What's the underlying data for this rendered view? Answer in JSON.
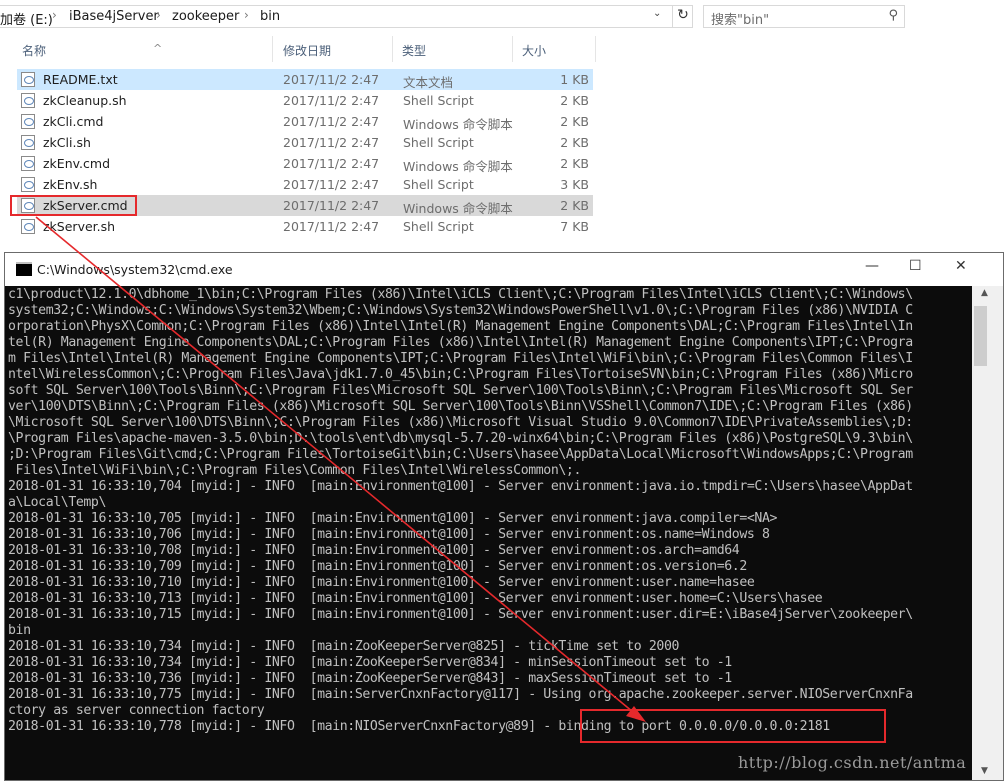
{
  "explorer": {
    "breadcrumbs": [
      "加卷 (E:)",
      "iBase4jServer",
      "zookeeper",
      "bin"
    ],
    "search_placeholder": "搜索\"bin\"",
    "columns": {
      "name": "名称",
      "date": "修改日期",
      "type": "类型",
      "size": "大小"
    },
    "files": [
      {
        "name": "README.txt",
        "date": "2017/11/2 2:47",
        "type": "文本文档",
        "size": "1 KB"
      },
      {
        "name": "zkCleanup.sh",
        "date": "2017/11/2 2:47",
        "type": "Shell Script",
        "size": "2 KB"
      },
      {
        "name": "zkCli.cmd",
        "date": "2017/11/2 2:47",
        "type": "Windows 命令脚本",
        "size": "2 KB"
      },
      {
        "name": "zkCli.sh",
        "date": "2017/11/2 2:47",
        "type": "Shell Script",
        "size": "2 KB"
      },
      {
        "name": "zkEnv.cmd",
        "date": "2017/11/2 2:47",
        "type": "Windows 命令脚本",
        "size": "2 KB"
      },
      {
        "name": "zkEnv.sh",
        "date": "2017/11/2 2:47",
        "type": "Shell Script",
        "size": "3 KB"
      },
      {
        "name": "zkServer.cmd",
        "date": "2017/11/2 2:47",
        "type": "Windows 命令脚本",
        "size": "2 KB"
      },
      {
        "name": "zkServer.sh",
        "date": "2017/11/2 2:47",
        "type": "Shell Script",
        "size": "7 KB"
      }
    ]
  },
  "cmd": {
    "title": "C:\\Windows\\system32\\cmd.exe",
    "lines": [
      "c1\\product\\12.1.0\\dbhome_1\\bin;C:\\Program Files (x86)\\Intel\\iCLS Client\\;C:\\Program Files\\Intel\\iCLS Client\\;C:\\Windows\\",
      "system32;C:\\Windows;C:\\Windows\\System32\\Wbem;C:\\Windows\\System32\\WindowsPowerShell\\v1.0\\;C:\\Program Files (x86)\\NVIDIA C",
      "orporation\\PhysX\\Common;C:\\Program Files (x86)\\Intel\\Intel(R) Management Engine Components\\DAL;C:\\Program Files\\Intel\\In",
      "tel(R) Management Engine Components\\DAL;C:\\Program Files (x86)\\Intel\\Intel(R) Management Engine Components\\IPT;C:\\Progra",
      "m Files\\Intel\\Intel(R) Management Engine Components\\IPT;C:\\Program Files\\Intel\\WiFi\\bin\\;C:\\Program Files\\Common Files\\I",
      "ntel\\WirelessCommon\\;C:\\Program Files\\Java\\jdk1.7.0_45\\bin;C:\\Program Files\\TortoiseSVN\\bin;C:\\Program Files (x86)\\Micro",
      "soft SQL Server\\100\\Tools\\Binn\\;C:\\Program Files\\Microsoft SQL Server\\100\\Tools\\Binn\\;C:\\Program Files\\Microsoft SQL Ser",
      "ver\\100\\DTS\\Binn\\;C:\\Program Files (x86)\\Microsoft SQL Server\\100\\Tools\\Binn\\VSShell\\Common7\\IDE\\;C:\\Program Files (x86)",
      "\\Microsoft SQL Server\\100\\DTS\\Binn\\;C:\\Program Files (x86)\\Microsoft Visual Studio 9.0\\Common7\\IDE\\PrivateAssemblies\\;D:",
      "\\Program Files\\apache-maven-3.5.0\\bin;D:\\tools\\ent\\db\\mysql-5.7.20-winx64\\bin;C:\\Program Files (x86)\\PostgreSQL\\9.3\\bin\\",
      ";D:\\Program Files\\Git\\cmd;C:\\Program Files\\TortoiseGit\\bin;C:\\Users\\hasee\\AppData\\Local\\Microsoft\\WindowsApps;C:\\Program",
      " Files\\Intel\\WiFi\\bin\\;C:\\Program Files\\Common Files\\Intel\\WirelessCommon\\;.",
      "2018-01-31 16:33:10,704 [myid:] - INFO  [main:Environment@100] - Server environment:java.io.tmpdir=C:\\Users\\hasee\\AppDat",
      "a\\Local\\Temp\\",
      "2018-01-31 16:33:10,705 [myid:] - INFO  [main:Environment@100] - Server environment:java.compiler=<NA>",
      "2018-01-31 16:33:10,706 [myid:] - INFO  [main:Environment@100] - Server environment:os.name=Windows 8",
      "2018-01-31 16:33:10,708 [myid:] - INFO  [main:Environment@100] - Server environment:os.arch=amd64",
      "2018-01-31 16:33:10,709 [myid:] - INFO  [main:Environment@100] - Server environment:os.version=6.2",
      "2018-01-31 16:33:10,710 [myid:] - INFO  [main:Environment@100] - Server environment:user.name=hasee",
      "2018-01-31 16:33:10,713 [myid:] - INFO  [main:Environment@100] - Server environment:user.home=C:\\Users\\hasee",
      "2018-01-31 16:33:10,715 [myid:] - INFO  [main:Environment@100] - Server environment:user.dir=E:\\iBase4jServer\\zookeeper\\",
      "bin",
      "2018-01-31 16:33:10,734 [myid:] - INFO  [main:ZooKeeperServer@825] - tickTime set to 2000",
      "2018-01-31 16:33:10,734 [myid:] - INFO  [main:ZooKeeperServer@834] - minSessionTimeout set to -1",
      "2018-01-31 16:33:10,736 [myid:] - INFO  [main:ZooKeeperServer@843] - maxSessionTimeout set to -1",
      "2018-01-31 16:33:10,775 [myid:] - INFO  [main:ServerCnxnFactory@117] - Using org.apache.zookeeper.server.NIOServerCnxnFa",
      "ctory as server connection factory",
      "2018-01-31 16:33:10,778 [myid:] - INFO  [main:NIOServerCnxnFactory@89] - binding to port 0.0.0.0/0.0.0.0:2181"
    ]
  },
  "watermark": "http://blog.csdn.net/antma",
  "colors": {
    "annotation_red": "#e5292c",
    "console_bg": "#0c0c0c",
    "console_fg": "#c0c0c0",
    "selected_row": "#d9d9d9"
  }
}
